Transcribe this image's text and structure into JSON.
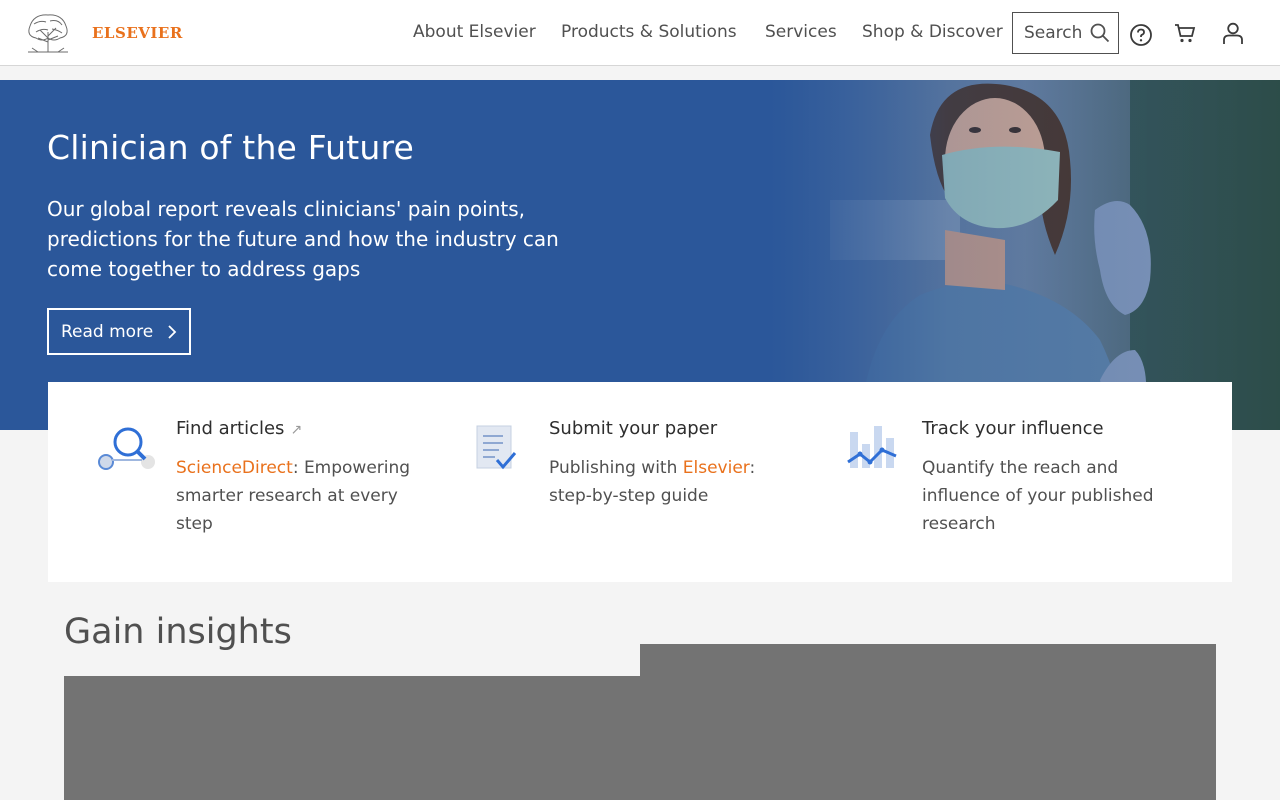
{
  "header": {
    "logo_text": "ELSEVIER",
    "nav": [
      "About Elsevier",
      "Products & Solutions",
      "Services",
      "Shop & Discover"
    ],
    "search_label": "Search",
    "icons": [
      "help-icon",
      "cart-icon",
      "user-icon"
    ]
  },
  "hero": {
    "title": "Clinician of the Future",
    "description": "Our global report reveals clinicians' pain points, predictions for the future and how the industry can come together to address gaps",
    "button": "Read more"
  },
  "cards": [
    {
      "title": "Find articles",
      "link": "ScienceDirect",
      "desc": ": Empowering smarter research at every step",
      "icon": "search-articles-icon"
    },
    {
      "title": "Submit your paper",
      "desc_pre": "Publishing with ",
      "link": "Elsevier",
      "desc": ": step-by-step guide",
      "icon": "document-check-icon"
    },
    {
      "title": "Track your influence",
      "desc": "Quantify the reach and influence of your published research",
      "icon": "chart-icon"
    }
  ],
  "section": {
    "title": "Gain insights"
  },
  "colors": {
    "brand_orange": "#e9711c",
    "hero_blue": "#2b579a",
    "text": "#505050"
  }
}
